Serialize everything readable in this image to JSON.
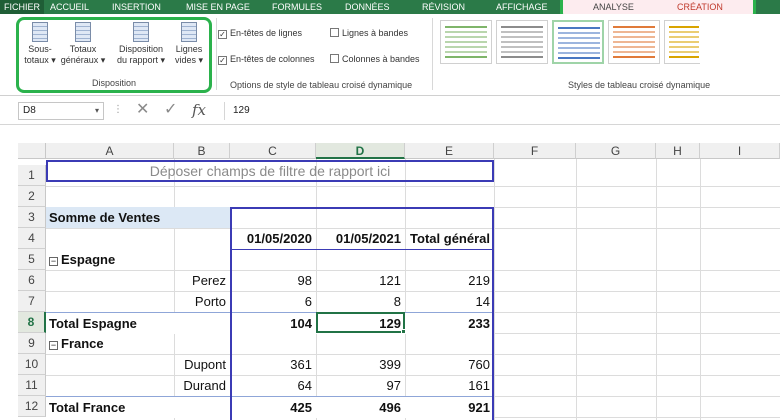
{
  "ribbon": {
    "tabs": [
      "FICHIER",
      "ACCUEIL",
      "INSERTION",
      "MISE EN PAGE",
      "FORMULES",
      "DONNÉES",
      "RÉVISION",
      "AFFICHAGE"
    ],
    "context_tabs": [
      "ANALYSE",
      "CRÉATION"
    ],
    "disposition": {
      "buttons": [
        {
          "line1": "Sous-",
          "line2": "totaux ▾"
        },
        {
          "line1": "Totaux",
          "line2": "généraux ▾"
        },
        {
          "line1": "Disposition",
          "line2": "du rapport ▾"
        },
        {
          "line1": "Lignes",
          "line2": "vides ▾"
        }
      ],
      "label": "Disposition"
    },
    "style_options": {
      "checks": [
        {
          "label": "En-têtes de lignes",
          "checked": true
        },
        {
          "label": "Lignes à bandes",
          "checked": false
        },
        {
          "label": "En-têtes de colonnes",
          "checked": true
        },
        {
          "label": "Colonnes à bandes",
          "checked": false
        }
      ],
      "label": "Options de style de tableau croisé dynamique"
    },
    "styles": {
      "label": "Styles de tableau croisé dynamique",
      "thumb_colors": [
        "#7fb56a",
        "#8c8c8c",
        "#4a78c2",
        "#e07a3a",
        "#d9a400"
      ]
    }
  },
  "formula_bar": {
    "name_box": "D8",
    "name_dropdown": "▾",
    "separator": "⋮",
    "cancel_icon": "✕",
    "enter_icon": "✓",
    "fx_label": "fx",
    "value": "129"
  },
  "grid": {
    "columns": [
      "A",
      "B",
      "C",
      "D",
      "E",
      "F",
      "G",
      "H",
      "I"
    ],
    "rows": [
      "1",
      "2",
      "3",
      "4",
      "5",
      "6",
      "7",
      "8",
      "9",
      "10",
      "11",
      "12"
    ],
    "active_column": "D",
    "active_row": "8"
  },
  "pivot": {
    "filter_placeholder": "Déposer champs de filtre de rapport ici",
    "value_header": "Somme de Ventes",
    "col_headers": [
      "01/05/2020",
      "01/05/2021",
      "Total général"
    ],
    "groups": [
      {
        "name": "Espagne",
        "items": [
          {
            "name": "Perez",
            "values": [
              "98",
              "121",
              "219"
            ]
          },
          {
            "name": "Porto",
            "values": [
              "6",
              "8",
              "14"
            ]
          }
        ],
        "total_label": "Total Espagne",
        "total": [
          "104",
          "129",
          "233"
        ]
      },
      {
        "name": "France",
        "items": [
          {
            "name": "Dupont",
            "values": [
              "361",
              "399",
              "760"
            ]
          },
          {
            "name": "Durand",
            "values": [
              "64",
              "97",
              "161"
            ]
          }
        ],
        "total_label": "Total France",
        "total": [
          "425",
          "496",
          "921"
        ]
      }
    ]
  }
}
